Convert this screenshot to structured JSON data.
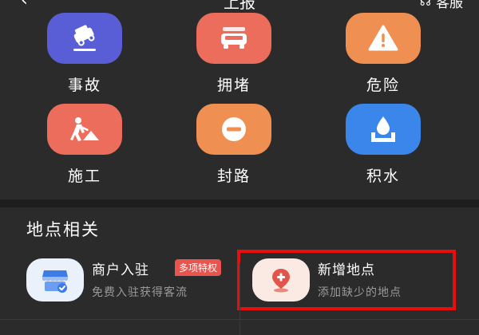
{
  "header": {
    "title": "上报",
    "back_icon": "chevron-left-icon",
    "right_label": "客服",
    "right_icon": "headset-icon"
  },
  "report_types": [
    {
      "label": "事故",
      "icon": "accident-car-icon",
      "color": "#5a5ed6"
    },
    {
      "label": "拥堵",
      "icon": "traffic-jam-car-icon",
      "color": "#ec6d5c"
    },
    {
      "label": "危险",
      "icon": "warning-triangle-icon",
      "color": "#ef8f51"
    },
    {
      "label": "施工",
      "icon": "construction-worker-icon",
      "color": "#ec6d5c"
    },
    {
      "label": "封路",
      "icon": "road-closed-icon",
      "color": "#ef8f51"
    },
    {
      "label": "积水",
      "icon": "water-drop-icon",
      "color": "#3a86ea"
    }
  ],
  "section": {
    "title": "地点相关",
    "cards": [
      {
        "title": "商户入驻",
        "subtitle": "免费入驻获得客流",
        "badge": "多项特权",
        "icon": "storefront-check-icon"
      },
      {
        "title": "新增地点",
        "subtitle": "添加缺少的地点",
        "icon": "add-location-pin-icon"
      }
    ]
  },
  "colors": {
    "background": "#2b2b2b",
    "highlight": "#e80e0e",
    "badge": "#e8554e"
  }
}
